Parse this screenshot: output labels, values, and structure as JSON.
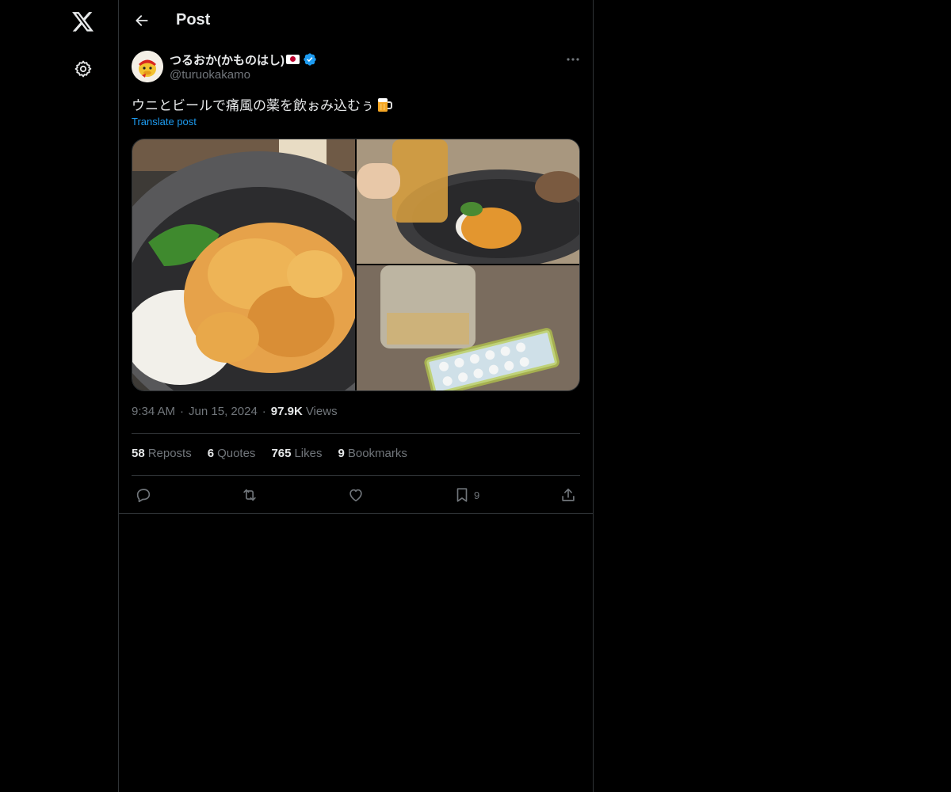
{
  "nav": {
    "logo_icon": "x-logo-icon",
    "settings_icon": "gear-icon"
  },
  "header": {
    "title": "Post",
    "back_icon": "arrow-left-icon"
  },
  "post": {
    "author": {
      "name": "つるおか(かものはし)",
      "handle": "@turuokakamo",
      "flag": "🇯🇵",
      "verified": true
    },
    "text": "ウニとビールで痛風の薬を飲ぉみ込むぅ",
    "emoji": "🍺",
    "translate_label": "Translate post",
    "media": [
      {
        "name": "uni-rice-bowl-photo",
        "alt": "Sea urchin on rice"
      },
      {
        "name": "beer-glass-photo",
        "alt": "Beer glass and uni bowl"
      },
      {
        "name": "pills-glass-photo",
        "alt": "Empty glass and medicine blister pack"
      }
    ],
    "time": "9:34 AM",
    "date": "Jun 15, 2024",
    "views_count": "97.9K",
    "views_label": "Views",
    "meta_separator": "·"
  },
  "stats": {
    "reposts": {
      "count": "58",
      "label": "Reposts"
    },
    "quotes": {
      "count": "6",
      "label": "Quotes"
    },
    "likes": {
      "count": "765",
      "label": "Likes"
    },
    "bookmarks": {
      "count": "9",
      "label": "Bookmarks"
    }
  },
  "actions": {
    "reply_icon": "reply-icon",
    "repost_icon": "repost-icon",
    "like_icon": "heart-icon",
    "bookmark_icon": "bookmark-icon",
    "bookmark_count": "9",
    "share_icon": "share-icon"
  },
  "colors": {
    "background": "#000000",
    "text_primary": "#e7e9ea",
    "text_secondary": "#71767b",
    "accent": "#1d9bf0",
    "border": "#2f3336"
  }
}
